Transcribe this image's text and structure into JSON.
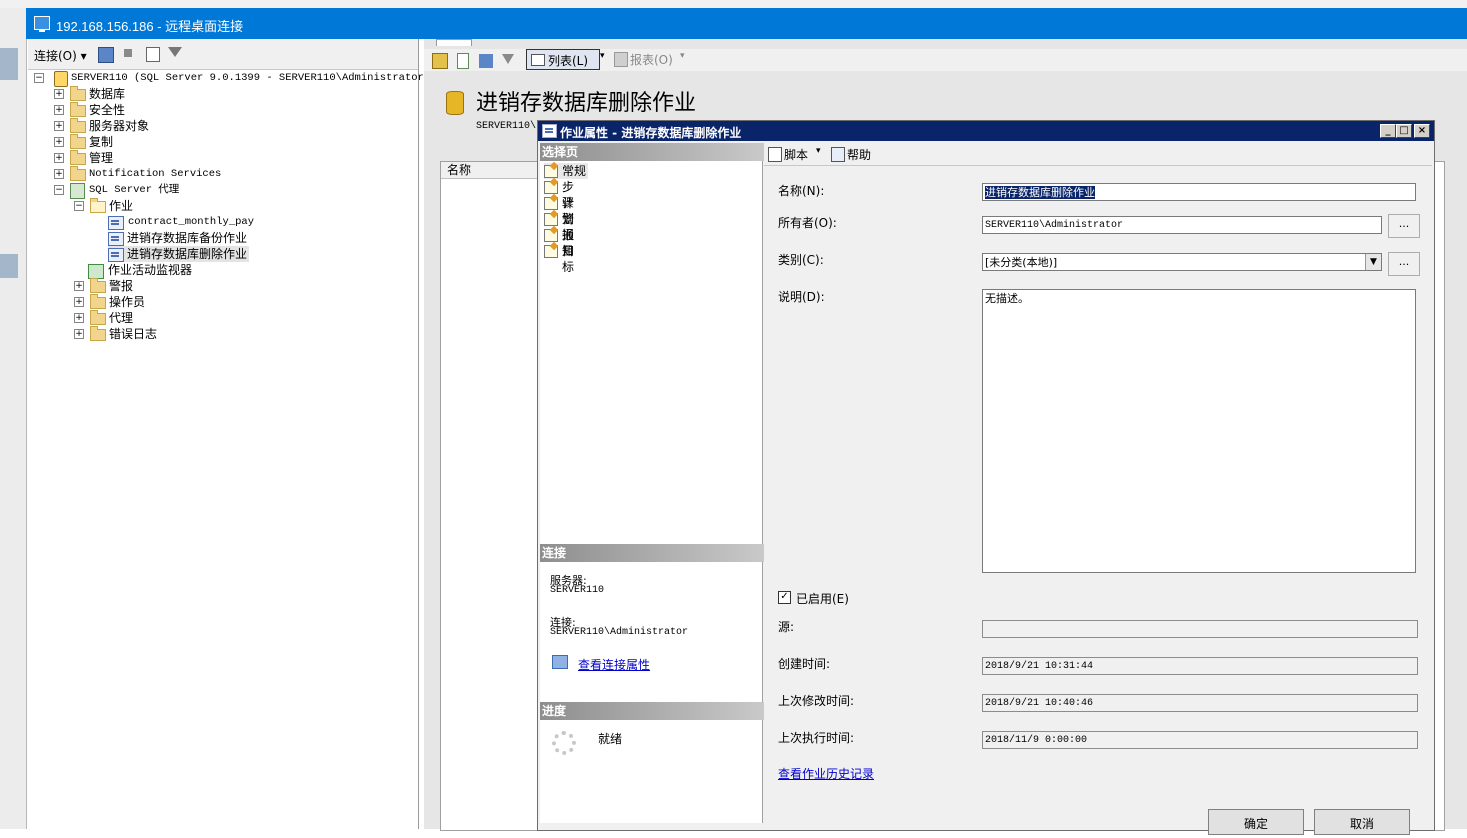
{
  "rdp": {
    "title": "192.168.156.186 - 远程桌面连接"
  },
  "object_explorer": {
    "toolbar": {
      "connect_label": "连接(O) ▾"
    },
    "tree": [
      {
        "label": "SERVER110 (SQL Server 9.0.1399 - SERVER110\\Administrator)"
      },
      {
        "label": "数据库"
      },
      {
        "label": "安全性"
      },
      {
        "label": "服务器对象"
      },
      {
        "label": "复制"
      },
      {
        "label": "管理"
      },
      {
        "label": "Notification Services"
      },
      {
        "label": "SQL Server 代理"
      },
      {
        "label": "作业"
      },
      {
        "label": "contract_monthly_pay"
      },
      {
        "label": "进销存数据库备份作业"
      },
      {
        "label": "进销存数据库删除作业"
      },
      {
        "label": "作业活动监视器"
      },
      {
        "label": "警报"
      },
      {
        "label": "操作员"
      },
      {
        "label": "代理"
      },
      {
        "label": "错误日志"
      }
    ]
  },
  "document": {
    "toolbar": {
      "list_label": "列表(L)",
      "report_label": "报表(O)"
    },
    "heading": "进销存数据库删除作业",
    "sub": "SERVER110\\",
    "grid_header": "名称"
  },
  "dialog": {
    "title": "作业属性 - 进销存数据库删除作业",
    "select_page_header": "选择页",
    "pages": [
      "常规",
      "步骤",
      "计划",
      "警报",
      "通知",
      "目标"
    ],
    "connection_header": "连接",
    "server_label": "服务器:",
    "server_value": "SERVER110",
    "connection_label": "连接:",
    "connection_value": "SERVER110\\Administrator",
    "view_connection_link": "查看连接属性",
    "progress_header": "进度",
    "progress_status": "就绪",
    "toolbar": {
      "script_label": "脚本",
      "help_label": "帮助"
    },
    "form": {
      "name_label": "名称(N):",
      "name_value": "进销存数据库删除作业",
      "owner_label": "所有者(O):",
      "owner_value": "SERVER110\\Administrator",
      "category_label": "类别(C):",
      "category_value": "[未分类(本地)]",
      "description_label": "说明(D):",
      "description_value": "无描述。",
      "enabled_label": "已启用(E)",
      "enabled": true,
      "source_label": "源:",
      "source_value": "",
      "created_label": "创建时间:",
      "created_value": "2018/9/21 10:31:44",
      "modified_label": "上次修改时间:",
      "modified_value": "2018/9/21 10:40:46",
      "executed_label": "上次执行时间:",
      "executed_value": "2018/11/9 0:00:00",
      "history_link": "查看作业历史记录",
      "browse_label": "..."
    },
    "buttons": {
      "ok": "确定",
      "cancel": "取消"
    }
  }
}
